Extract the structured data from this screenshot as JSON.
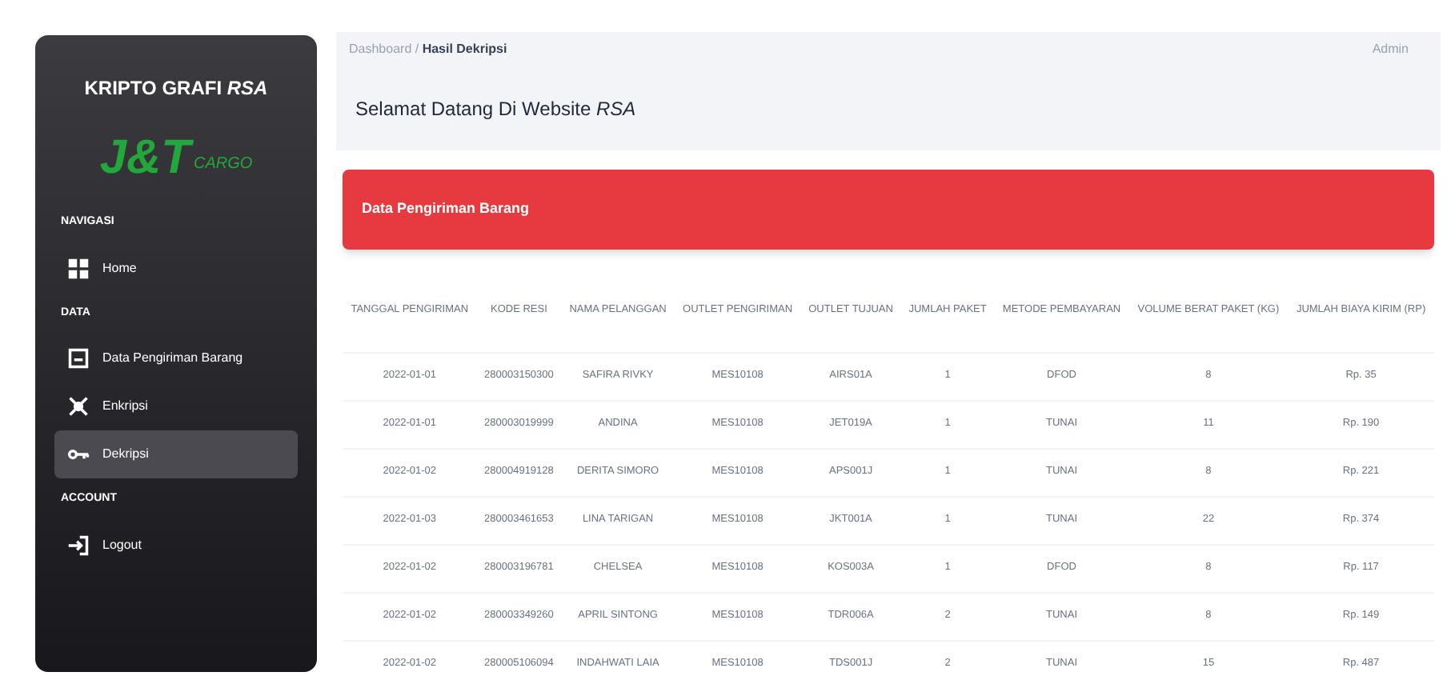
{
  "sidebar": {
    "title": "KRIPTO GRAFI *RSA*",
    "logo": {
      "main": "J&T",
      "sub": "CARGO"
    },
    "sections": [
      {
        "heading": "NAVIGASI",
        "items": [
          {
            "label": "Home",
            "kind": "grid",
            "selected": false
          }
        ]
      },
      {
        "heading": "DATA",
        "items": [
          {
            "label": "Data Pengiriman Barang",
            "kind": "box",
            "selected": false
          },
          {
            "label": "Enkripsi",
            "kind": "cross",
            "selected": false
          },
          {
            "label": "Dekripsi",
            "kind": "key",
            "selected": true
          }
        ]
      },
      {
        "heading": "ACCOUNT",
        "items": [
          {
            "label": "Logout",
            "kind": "logout",
            "selected": false
          }
        ]
      }
    ]
  },
  "breadcrumb": {
    "items": [
      "Dashboard",
      "Hasil Dekripsi"
    ],
    "separator": "/"
  },
  "user": "Admin",
  "heading": "Selamat Datang Di Website *RSA*",
  "card_title": "Data Pengiriman Barang",
  "table": {
    "columns": [
      "TANGGAL PENGIRIMAN",
      "KODE RESI",
      "NAMA PELANGGAN",
      "OUTLET PENGIRIMAN",
      "OUTLET TUJUAN",
      "JUMLAH PAKET",
      "METODE PEMBAYARAN",
      "VOLUME BERAT PAKET (KG)",
      "JUMLAH BIAYA KIRIM (RP)"
    ],
    "rows": [
      [
        "2022-01-01",
        "280003150300",
        "SAFIRA RIVKY",
        "MES10108",
        "AIRS01A",
        "1",
        "DFOD",
        "8",
        "Rp. 35"
      ],
      [
        "2022-01-01",
        "280003019999",
        "ANDINA",
        "MES10108",
        "JET019A",
        "1",
        "TUNAI",
        "11",
        "Rp. 190"
      ],
      [
        "2022-01-02",
        "280004919128",
        "DERITA SIMORO",
        "MES10108",
        "APS001J",
        "1",
        "TUNAI",
        "8",
        "Rp. 221"
      ],
      [
        "2022-01-03",
        "280003461653",
        "LINA TARIGAN",
        "MES10108",
        "JKT001A",
        "1",
        "TUNAI",
        "22",
        "Rp. 374"
      ],
      [
        "2022-01-02",
        "280003196781",
        "CHELSEA",
        "MES10108",
        "KOS003A",
        "1",
        "DFOD",
        "8",
        "Rp. 117"
      ],
      [
        "2022-01-02",
        "280003349260",
        "APRIL SINTONG",
        "MES10108",
        "TDR006A",
        "2",
        "TUNAI",
        "8",
        "Rp. 149"
      ],
      [
        "2022-01-02",
        "280005106094",
        "INDAHWATI LAIA",
        "MES10108",
        "TDS001J",
        "2",
        "TUNAI",
        "15",
        "Rp. 487"
      ]
    ]
  }
}
